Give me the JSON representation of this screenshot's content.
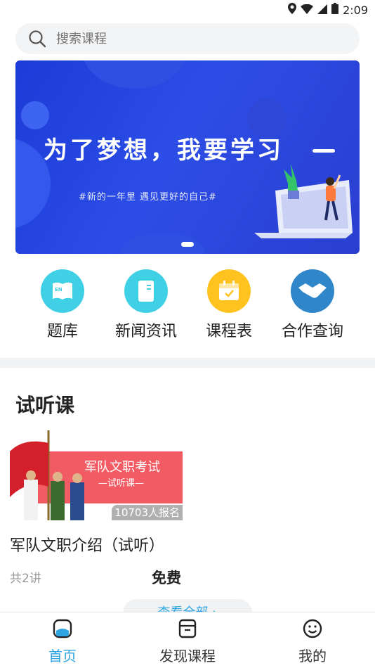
{
  "status_bar": {
    "time": "2:09"
  },
  "search": {
    "placeholder": "搜索课程"
  },
  "banner": {
    "title": "为了梦想，我要学习",
    "subtitle": "#新的一年里 遇见更好的自己#"
  },
  "quick_nav": [
    {
      "label": "题库",
      "icon": "book-icon",
      "color": "#3fd0e6"
    },
    {
      "label": "新闻资讯",
      "icon": "document-icon",
      "color": "#3fd0e6"
    },
    {
      "label": "课程表",
      "icon": "calendar-icon",
      "color": "#ffc21f"
    },
    {
      "label": "合作查询",
      "icon": "handshake-icon",
      "color": "#2f86c9"
    }
  ],
  "trial_section": {
    "title": "试听课",
    "course": {
      "thumb_title": "军队文职考试",
      "thumb_subtitle": "—试听课—",
      "enrolled": "10703人报名",
      "name": "军队文职介绍（试听）",
      "lessons": "共2讲",
      "price": "免费"
    },
    "view_all": "查看全部 ›"
  },
  "tab_bar": [
    {
      "label": "首页",
      "icon": "home-icon",
      "active": true
    },
    {
      "label": "发现课程",
      "icon": "discover-icon",
      "active": false
    },
    {
      "label": "我的",
      "icon": "profile-icon",
      "active": false
    }
  ],
  "colors": {
    "accent": "#2fa4e0",
    "banner": "#2c4de6"
  }
}
